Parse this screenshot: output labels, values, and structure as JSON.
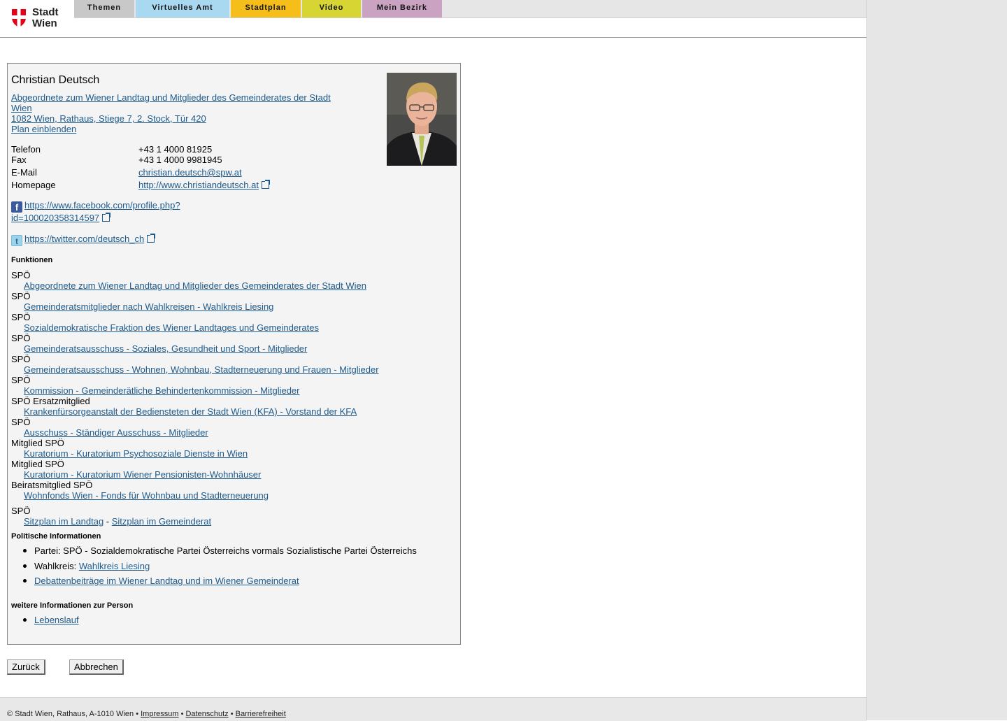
{
  "nav": {
    "logo_line1": "Stadt",
    "logo_line2": "Wien",
    "tabs": [
      {
        "label": "Themen",
        "color": "#c8c8c8"
      },
      {
        "label": "Virtuelles Amt",
        "color": "#a9d8f1"
      },
      {
        "label": "Stadtplan",
        "color": "#f5be1b"
      },
      {
        "label": "Video",
        "color": "#d6d534"
      },
      {
        "label": "Mein Bezirk",
        "color": "#c9a3c1"
      }
    ]
  },
  "person": {
    "name": "Christian Deutsch",
    "role_link_line1": "Abgeordnete zum Wiener Landtag und Mitglieder des Gemeinderates der Stadt",
    "role_link_line2": "Wien",
    "address": "1082 Wien, Rathaus, Stiege 7, 2. Stock, Tür 420",
    "plan": "Plan einblenden",
    "contacts": {
      "telefon_label": "Telefon",
      "telefon": "+43 1 4000 81925",
      "fax_label": "Fax",
      "fax": "+43 1 4000 9981945",
      "email_label": "E-Mail",
      "email": "christian.deutsch@spw.at",
      "homepage_label": "Homepage",
      "homepage": "http://www.christiandeutsch.at"
    },
    "facebook_line1": "https://www.facebook.com/profile.php?",
    "facebook_line2": "id=100020358314597",
    "twitter": "https://twitter.com/deutsch_ch"
  },
  "funktionen": {
    "heading": "Funktionen",
    "items": [
      {
        "party": "SPÖ",
        "link": "Abgeordnete zum Wiener Landtag und Mitglieder des Gemeinderates der Stadt Wien"
      },
      {
        "party": "SPÖ",
        "link": "Gemeinderatsmitglieder nach Wahlkreisen - Wahlkreis Liesing"
      },
      {
        "party": "SPÖ",
        "link": "Sozialdemokratische Fraktion des Wiener Landtages und Gemeinderates"
      },
      {
        "party": "SPÖ",
        "link": "Gemeinderatsausschuss - Soziales, Gesundheit und Sport - Mitglieder"
      },
      {
        "party": "SPÖ",
        "link": "Gemeinderatsausschuss - Wohnen, Wohnbau, Stadterneuerung und Frauen - Mitglieder"
      },
      {
        "party": "SPÖ",
        "link": "Kommission - Gemeinderätliche Behindertenkommission - Mitglieder"
      },
      {
        "party": "SPÖ Ersatzmitglied",
        "link": "Krankenfürsorgeanstalt der Bediensteten der Stadt Wien (KFA) - Vorstand der KFA"
      },
      {
        "party": "SPÖ",
        "link": "Ausschuss - Ständiger Ausschuss - Mitglieder"
      },
      {
        "party": "Mitglied SPÖ",
        "link": "Kuratorium - Kuratorium Psychosoziale Dienste in Wien"
      },
      {
        "party": "Mitglied SPÖ",
        "link": "Kuratorium - Kuratorium Wiener Pensionisten-Wohnhäuser"
      },
      {
        "party": "Beiratsmitglied SPÖ",
        "link": "Wohnfonds Wien - Fonds für Wohnbau und Stadterneuerung"
      }
    ],
    "last_party": "SPÖ",
    "sitzplan_landtag": "Sitzplan im Landtag",
    "sitzplan_sep": " - ",
    "sitzplan_gemeinderat": "Sitzplan im Gemeinderat"
  },
  "politisch": {
    "heading": "Politische Informationen",
    "partei": "Partei: SPÖ - Sozialdemokratische Partei Österreichs vormals Sozialistische Partei Österreichs",
    "wahlkreis_label": "Wahlkreis: ",
    "wahlkreis_link": "Wahlkreis Liesing",
    "debatten": "Debattenbeiträge im Wiener Landtag und im Wiener Gemeinderat"
  },
  "weitere": {
    "heading": "weitere Informationen zur Person",
    "lebenslauf": "Lebenslauf"
  },
  "buttons": {
    "back": "Zurück",
    "cancel": "Abbrechen"
  },
  "footer": {
    "copyright": "© Stadt Wien, Rathaus, A-1010 Wien • ",
    "impressum": "Impressum",
    "sep1": " • ",
    "datenschutz": "Datenschutz",
    "sep2": " • ",
    "barrierefreiheit": "Barrierefreiheit"
  }
}
